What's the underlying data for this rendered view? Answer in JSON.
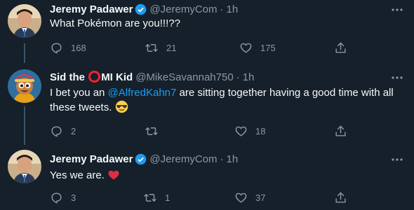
{
  "tweets": [
    {
      "author": "Jeremy Padawer",
      "verified": true,
      "handle": "@JeremyCom",
      "time": "1h",
      "text": "What Pokémon are you!!!??",
      "replies": "168",
      "retweets": "21",
      "likes": "175"
    },
    {
      "author_prefix": "Sid the",
      "author_suffix": "MI Kid",
      "verified": false,
      "handle": "@MikeSavannah750",
      "time": "1h",
      "text_before": "I bet you an",
      "mention": "@AlfredKahn7",
      "text_after": "are sitting together having a good time with all these tweets.",
      "replies": "2",
      "retweets": "",
      "likes": "18"
    },
    {
      "author": "Jeremy Padawer",
      "verified": true,
      "handle": "@JeremyCom",
      "time": "1h",
      "text": "Yes we are.",
      "replies": "3",
      "retweets": "1",
      "likes": "37"
    }
  ],
  "separator": "·",
  "colors": {
    "background": "#15202b",
    "text": "#f7f9f9",
    "muted": "#8b98a5",
    "link": "#1d9bf0",
    "verified": "#1d9bf0",
    "heart": "#f4212e",
    "thread_line": "#3d5466"
  },
  "icons": [
    "reply-icon",
    "retweet-icon",
    "like-icon",
    "share-icon",
    "more-icon",
    "verified-icon",
    "sunglasses-emoji",
    "red-heart-emoji"
  ]
}
